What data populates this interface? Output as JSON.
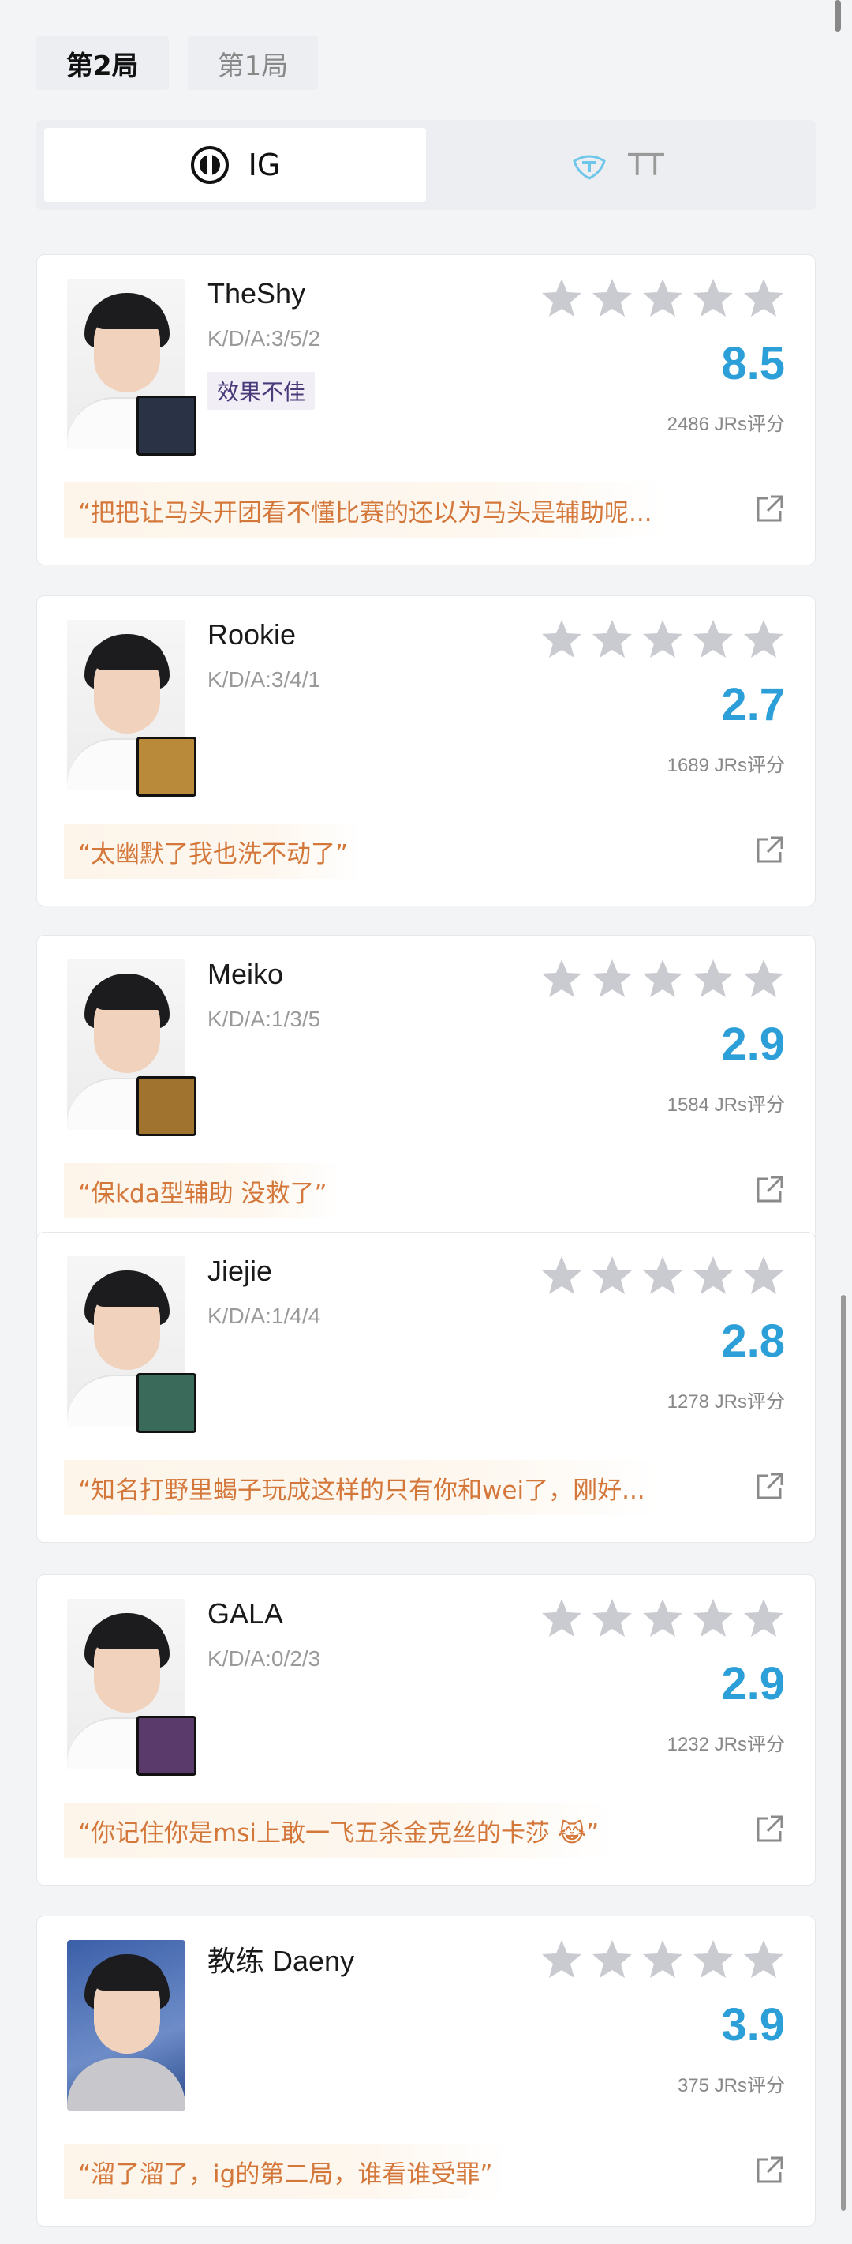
{
  "round_tabs": [
    {
      "label": "第2局",
      "active": true
    },
    {
      "label": "第1局",
      "active": false
    }
  ],
  "teams": [
    {
      "label": "IG",
      "active": true,
      "icon": "ig-logo-icon"
    },
    {
      "label": "TT",
      "active": false,
      "icon": "tt-logo-icon"
    }
  ],
  "colors": {
    "score": "#2c9fd8",
    "comment": "#d4773a",
    "star_empty": "#c9cbd1"
  },
  "players": [
    {
      "name": "TheShy",
      "kda": "K/D/A:3/5/2",
      "badge": "效果不佳",
      "score": "8.5",
      "raters": "2486 JRs评分",
      "comment": "“把把让马头开团看不懂比赛的还以为马头是辅助呢...",
      "stars_filled": 0,
      "champ_color": "#2a3346"
    },
    {
      "name": "Rookie",
      "kda": "K/D/A:3/4/1",
      "badge": "",
      "score": "2.7",
      "raters": "1689 JRs评分",
      "comment": "“太幽默了我也洗不动了”",
      "stars_filled": 0,
      "champ_color": "#b88a3a"
    },
    {
      "name": "Meiko",
      "kda": "K/D/A:1/3/5",
      "badge": "",
      "score": "2.9",
      "raters": "1584 JRs评分",
      "comment": "“保kda型辅助 没救了”",
      "stars_filled": 0,
      "champ_color": "#a0742e"
    },
    {
      "name": "Jiejie",
      "kda": "K/D/A:1/4/4",
      "badge": "",
      "score": "2.8",
      "raters": "1278 JRs评分",
      "comment": "“知名打野里蝎子玩成这样的只有你和wei了，刚好...",
      "stars_filled": 0,
      "champ_color": "#3a6a5a"
    },
    {
      "name": "GALA",
      "kda": "K/D/A:0/2/3",
      "badge": "",
      "score": "2.9",
      "raters": "1232 JRs评分",
      "comment": "“你记住你是msi上敢一飞五杀金克丝的卡莎 😹”",
      "stars_filled": 0,
      "champ_color": "#5a3a6a"
    },
    {
      "name": "教练 Daeny",
      "kda": "",
      "badge": "",
      "score": "3.9",
      "raters": "375 JRs评分",
      "comment": "“溜了溜了，ig的第二局，谁看谁受罪”",
      "stars_filled": 0,
      "champ_color": ""
    }
  ]
}
